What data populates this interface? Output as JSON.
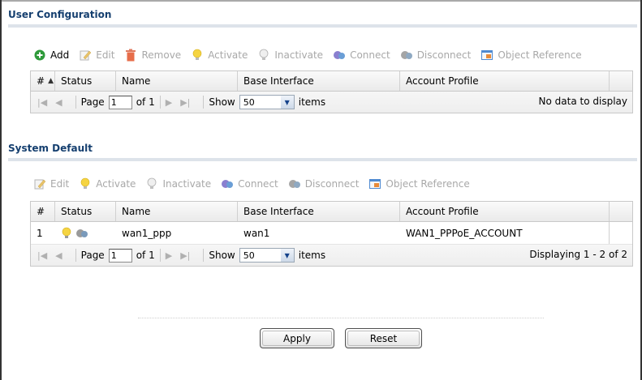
{
  "user_config": {
    "title": "User Configuration",
    "toolbar": [
      {
        "label": "Add",
        "icon": "add-icon",
        "enabled": true
      },
      {
        "label": "Edit",
        "icon": "edit-icon",
        "enabled": false
      },
      {
        "label": "Remove",
        "icon": "remove-icon",
        "enabled": false
      },
      {
        "label": "Activate",
        "icon": "activate-icon",
        "enabled": false
      },
      {
        "label": "Inactivate",
        "icon": "inactivate-icon",
        "enabled": false
      },
      {
        "label": "Connect",
        "icon": "connect-icon",
        "enabled": false
      },
      {
        "label": "Disconnect",
        "icon": "disconnect-icon",
        "enabled": false
      },
      {
        "label": "Object Reference",
        "icon": "object-reference-icon",
        "enabled": false
      }
    ],
    "columns": [
      "#",
      "Status",
      "Name",
      "Base Interface",
      "Account Profile"
    ],
    "pager": {
      "page_label": "Page",
      "page_value": "1",
      "of_label": "of 1",
      "show_label": "Show",
      "show_value": "50",
      "items_label": "items",
      "status": "No data to display"
    }
  },
  "system_default": {
    "title": "System Default",
    "toolbar": [
      {
        "label": "Edit",
        "icon": "edit-icon",
        "enabled": false
      },
      {
        "label": "Activate",
        "icon": "activate-icon",
        "enabled": false
      },
      {
        "label": "Inactivate",
        "icon": "inactivate-icon",
        "enabled": false
      },
      {
        "label": "Connect",
        "icon": "connect-icon",
        "enabled": false
      },
      {
        "label": "Disconnect",
        "icon": "disconnect-icon",
        "enabled": false
      },
      {
        "label": "Object Reference",
        "icon": "object-reference-icon",
        "enabled": false
      }
    ],
    "columns": [
      "#",
      "Status",
      "Name",
      "Base Interface",
      "Account Profile"
    ],
    "rows": [
      {
        "num": "1",
        "status_icons": [
          "bulb-on-icon",
          "connection-icon"
        ],
        "name": "wan1_ppp",
        "base": "wan1",
        "account": "WAN1_PPPoE_ACCOUNT"
      }
    ],
    "pager": {
      "page_label": "Page",
      "page_value": "1",
      "of_label": "of 1",
      "show_label": "Show",
      "show_value": "50",
      "items_label": "items",
      "status": "Displaying 1 - 2 of 2"
    }
  },
  "buttons": {
    "apply": "Apply",
    "reset": "Reset"
  },
  "colors": {
    "section_title": "#153f6f",
    "section_rule": "#dde3ea",
    "disabled_text": "#a8a8a8"
  }
}
